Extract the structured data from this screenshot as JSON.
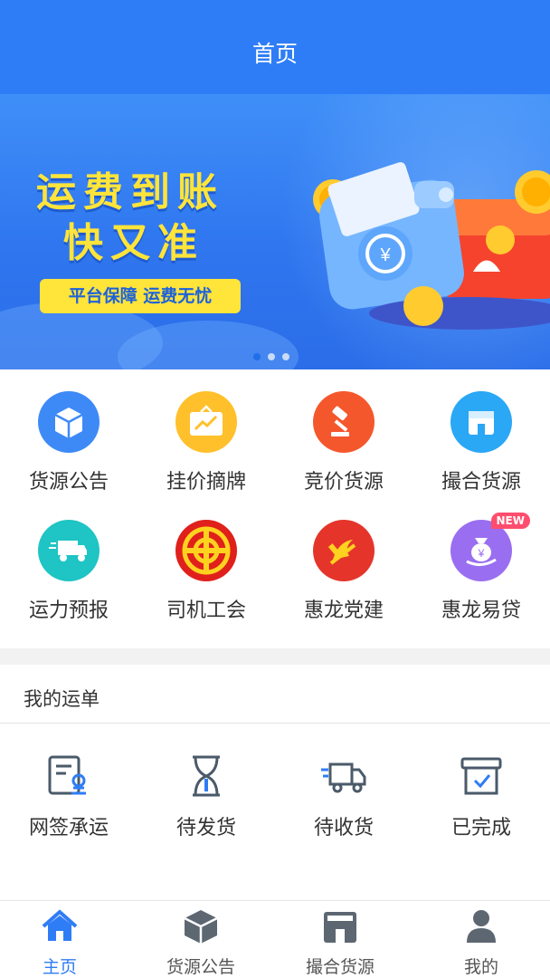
{
  "header": {
    "title": "首页"
  },
  "banner": {
    "headline_line1": "运费到账",
    "headline_line2": "快又准",
    "tagline": "平台保障 运费无忧",
    "carousel_dots": 3,
    "active_dot": 1
  },
  "grid": {
    "items": [
      {
        "label": "货源公告",
        "icon": "box-icon",
        "color": "#3d8af7"
      },
      {
        "label": "挂价摘牌",
        "icon": "price-board-icon",
        "color": "#ffc02b"
      },
      {
        "label": "竞价货源",
        "icon": "auction-hammer-icon",
        "color": "#f5572d"
      },
      {
        "label": "撮合货源",
        "icon": "store-icon",
        "color": "#2aa7f5"
      },
      {
        "label": "运力预报",
        "icon": "truck-icon",
        "color": "#1fc4c4"
      },
      {
        "label": "司机工会",
        "icon": "union-emblem-icon",
        "color": "#e0201b"
      },
      {
        "label": "惠龙党建",
        "icon": "party-emblem-icon",
        "color": "#e5352b"
      },
      {
        "label": "惠龙易贷",
        "icon": "money-bag-icon",
        "color": "#9a6ef0",
        "badge": "NEW"
      }
    ]
  },
  "orders": {
    "title": "我的运单",
    "items": [
      {
        "label": "网签承运",
        "icon": "contract-sign-icon"
      },
      {
        "label": "待发货",
        "icon": "hourglass-icon"
      },
      {
        "label": "待收货",
        "icon": "delivery-truck-icon"
      },
      {
        "label": "已完成",
        "icon": "completed-box-icon"
      }
    ]
  },
  "tabbar": {
    "items": [
      {
        "label": "主页",
        "icon": "home-icon",
        "active": true
      },
      {
        "label": "货源公告",
        "icon": "box-icon",
        "active": false
      },
      {
        "label": "撮合货源",
        "icon": "store-icon",
        "active": false
      },
      {
        "label": "我的",
        "icon": "user-icon",
        "active": false
      }
    ]
  },
  "colors": {
    "primary": "#2f7df6",
    "banner_yellow": "#ffe43a",
    "badge_red": "#ff4d6d"
  }
}
